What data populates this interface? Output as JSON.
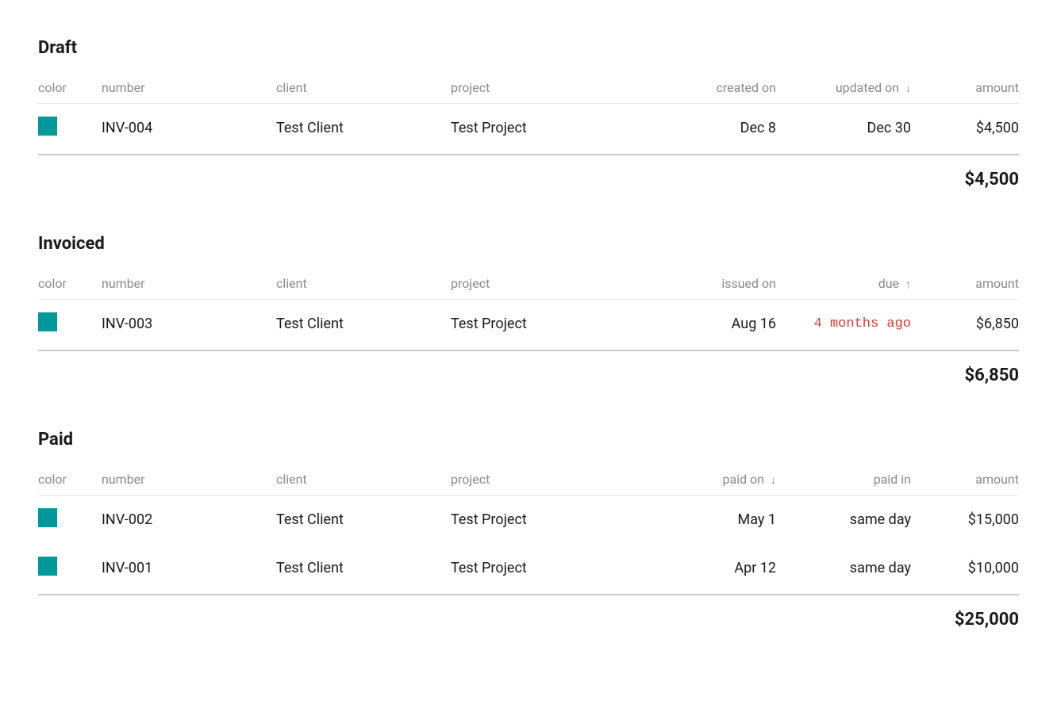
{
  "colors": {
    "swatch": "#009999",
    "overdue": "#d63a2f"
  },
  "sections": {
    "draft": {
      "title": "Draft",
      "headers": {
        "color": "color",
        "number": "number",
        "client": "client",
        "project": "project",
        "date1": "created on",
        "date2": "updated on",
        "date2_sort": "↓",
        "amount": "amount"
      },
      "rows": [
        {
          "number": "INV-004",
          "client": "Test Client",
          "project": "Test Project",
          "date1": "Dec 8",
          "date2": "Dec 30",
          "amount": "$4,500"
        }
      ],
      "total": "$4,500"
    },
    "invoiced": {
      "title": "Invoiced",
      "headers": {
        "color": "color",
        "number": "number",
        "client": "client",
        "project": "project",
        "date1": "issued on",
        "date2": "due",
        "date2_sort": "↑",
        "amount": "amount"
      },
      "rows": [
        {
          "number": "INV-003",
          "client": "Test Client",
          "project": "Test Project",
          "date1": "Aug 16",
          "date2": "4 months ago",
          "date2_overdue": true,
          "amount": "$6,850"
        }
      ],
      "total": "$6,850"
    },
    "paid": {
      "title": "Paid",
      "headers": {
        "color": "color",
        "number": "number",
        "client": "client",
        "project": "project",
        "date1": "paid on",
        "date1_sort": "↓",
        "date2": "paid in",
        "amount": "amount"
      },
      "rows": [
        {
          "number": "INV-002",
          "client": "Test Client",
          "project": "Test Project",
          "date1": "May 1",
          "date2": "same day",
          "amount": "$15,000"
        },
        {
          "number": "INV-001",
          "client": "Test Client",
          "project": "Test Project",
          "date1": "Apr 12",
          "date2": "same day",
          "amount": "$10,000"
        }
      ],
      "total": "$25,000"
    }
  }
}
